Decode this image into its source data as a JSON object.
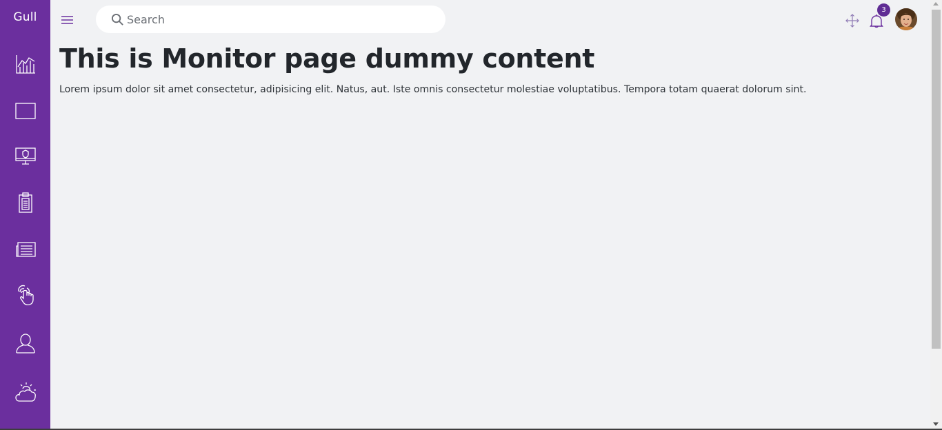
{
  "app": {
    "brand": "Gull"
  },
  "sidebar": {
    "background": "#6b2f9e",
    "items": [
      {
        "icon": "bar-chart-icon"
      },
      {
        "icon": "window-icon"
      },
      {
        "icon": "monitor-shield-icon"
      },
      {
        "icon": "clipboard-icon"
      },
      {
        "icon": "newspaper-icon"
      },
      {
        "icon": "touch-hand-icon"
      },
      {
        "icon": "user-icon"
      },
      {
        "icon": "weather-cloud-sun-icon"
      }
    ]
  },
  "header": {
    "search_placeholder": "Search",
    "notification_count": "3",
    "accent": "#5f2c94"
  },
  "main": {
    "title": "This is Monitor page dummy content",
    "body": "Lorem ipsum dolor sit amet consectetur, adipisicing elit. Natus, aut. Iste omnis consectetur molestiae voluptatibus. Tempora totam quaerat dolorum sint."
  }
}
